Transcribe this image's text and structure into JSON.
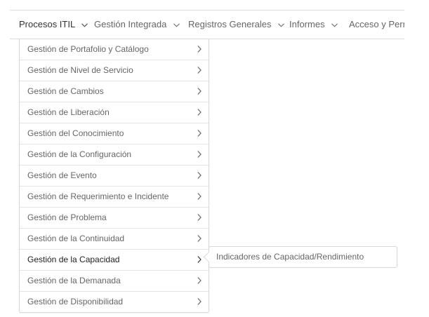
{
  "nav": {
    "items": [
      {
        "label": "Procesos ITIL"
      },
      {
        "label": "Gestión Integrada"
      },
      {
        "label": "Registros Generales"
      },
      {
        "label": "Informes"
      },
      {
        "label": "Acceso y Perm"
      }
    ]
  },
  "menu": {
    "items": [
      {
        "label": "Gestión de Portafolio y Catálogo"
      },
      {
        "label": "Gestión de Nivel de Servicio"
      },
      {
        "label": "Gestión de Cambios"
      },
      {
        "label": "Gestión de Liberación"
      },
      {
        "label": "Gestión del Conocimiento"
      },
      {
        "label": "Gestión de la Configuración"
      },
      {
        "label": "Gestión de Evento"
      },
      {
        "label": "Gestión de Requerimiento e Incidente"
      },
      {
        "label": "Gestión de Problema"
      },
      {
        "label": "Gestión de la Continuidad"
      },
      {
        "label": "Gestión de la Capacidad"
      },
      {
        "label": "Gestión de la Demanada"
      },
      {
        "label": "Gestión de Disponibilidad"
      }
    ]
  },
  "submenu": {
    "items": [
      {
        "label": "Indicadores de Capacidad/Rendimiento"
      }
    ]
  }
}
